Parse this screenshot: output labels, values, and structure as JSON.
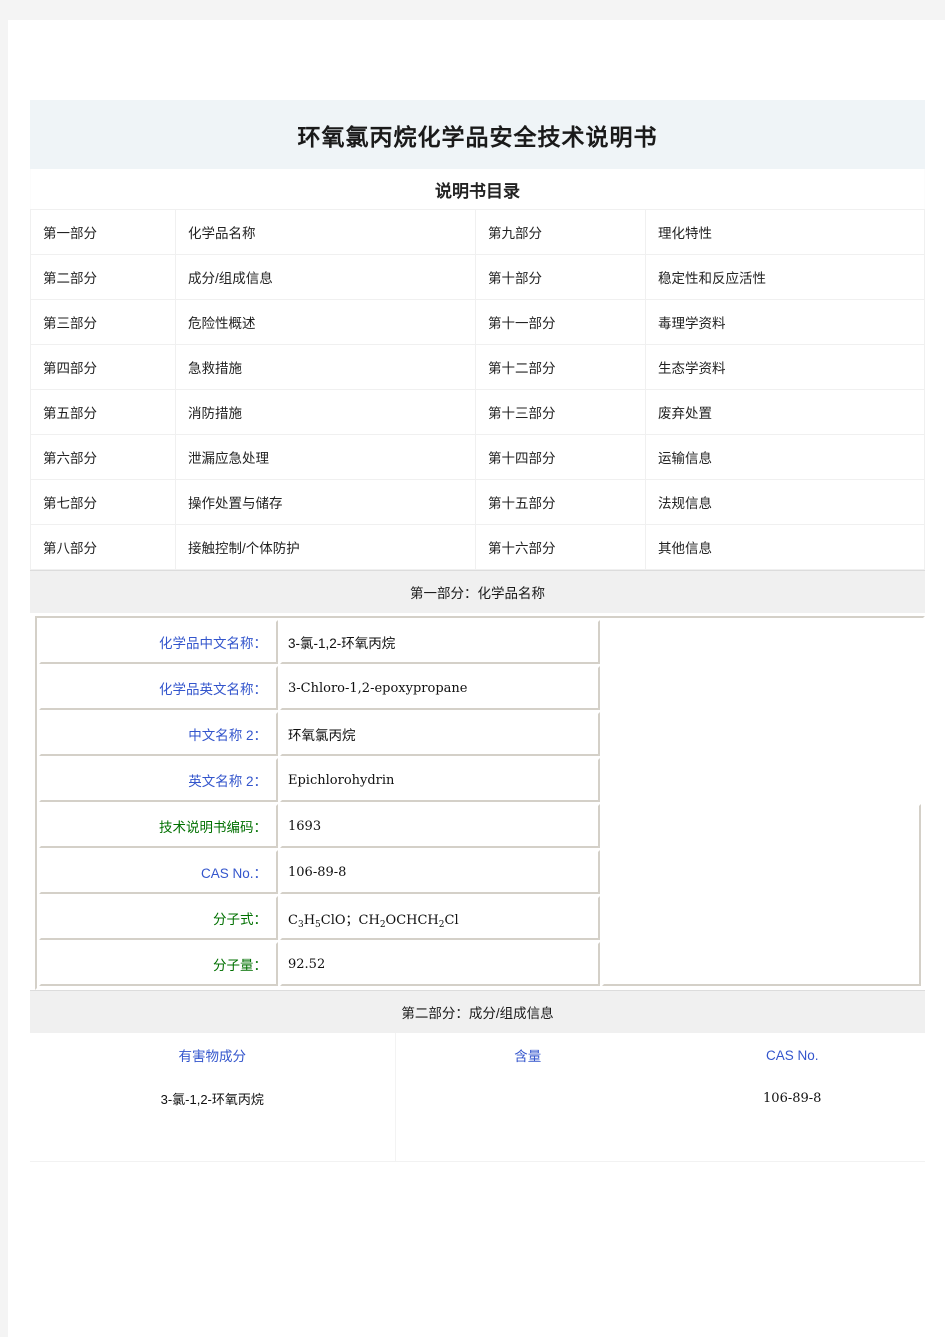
{
  "document": {
    "title": "环氧氯丙烷化学品安全技术说明书",
    "toc_caption": "说明书目录"
  },
  "toc": {
    "rows": [
      {
        "left_no": "第一部分",
        "left_name": "化学品名称",
        "right_no": "第九部分",
        "right_name": "理化特性"
      },
      {
        "left_no": "第二部分",
        "left_name": "成分/组成信息",
        "right_no": "第十部分",
        "right_name": "稳定性和反应活性"
      },
      {
        "left_no": "第三部分",
        "left_name": "危险性概述",
        "right_no": "第十一部分",
        "right_name": "毒理学资料"
      },
      {
        "left_no": "第四部分",
        "left_name": "急救措施",
        "right_no": "第十二部分",
        "right_name": "生态学资料"
      },
      {
        "left_no": "第五部分",
        "left_name": "消防措施",
        "right_no": "第十三部分",
        "right_name": "废弃处置"
      },
      {
        "left_no": "第六部分",
        "left_name": "泄漏应急处理",
        "right_no": "第十四部分",
        "right_name": "运输信息"
      },
      {
        "left_no": "第七部分",
        "left_name": "操作处置与储存",
        "right_no": "第十五部分",
        "right_name": "法规信息"
      },
      {
        "left_no": "第八部分",
        "left_name": "接触控制/个体防护",
        "right_no": "第十六部分",
        "right_name": "其他信息"
      }
    ]
  },
  "section_one": {
    "heading": "第一部分：化学品名称",
    "fields": [
      {
        "label": "化学品中文名称：",
        "value": "3-氯-1,2-环氧丙烷",
        "color": "blue",
        "value_lang": "cn"
      },
      {
        "label": "化学品英文名称：",
        "value": "3-Chloro-1,2-epoxypropane",
        "color": "blue",
        "value_lang": "en"
      },
      {
        "label": "中文名称 2：",
        "value": "环氧氯丙烷",
        "color": "blue",
        "value_lang": "cn"
      },
      {
        "label": "英文名称 2：",
        "value": "Epichlorohydrin",
        "color": "blue",
        "value_lang": "en"
      },
      {
        "label": "技术说明书编码：",
        "value": "1693",
        "color": "green",
        "value_lang": "en"
      },
      {
        "label": "CAS No.：",
        "value": "106-89-8",
        "color": "blue",
        "value_lang": "en"
      },
      {
        "label": "分子式：",
        "value": "C3H5ClO；CH2OCHCH2Cl",
        "color": "green",
        "value_lang": "formula"
      },
      {
        "label": "分子量：",
        "value": "92.52",
        "color": "green",
        "value_lang": "en"
      }
    ],
    "molecular_formula_parts": {
      "p1": "C",
      "s1": "3",
      "p2": "H",
      "s2": "5",
      "p3": "ClO；CH",
      "s3": "2",
      "p4": "OCHCH",
      "s4": "2",
      "p5": "Cl"
    }
  },
  "section_two": {
    "heading": "第二部分：成分/组成信息",
    "headers": [
      "有害物成分",
      "含量",
      "CAS No."
    ],
    "rows": [
      {
        "component": "3-氯-1,2-环氧丙烷",
        "content": "",
        "cas": "106-89-8"
      }
    ]
  },
  "colors": {
    "title_band": "#eff4f7",
    "section_band": "#f0f0f0",
    "label_blue": "#3355cc",
    "label_green": "#007000",
    "page_bg": "#ffffff",
    "outer_bg": "#f4f4f4"
  }
}
